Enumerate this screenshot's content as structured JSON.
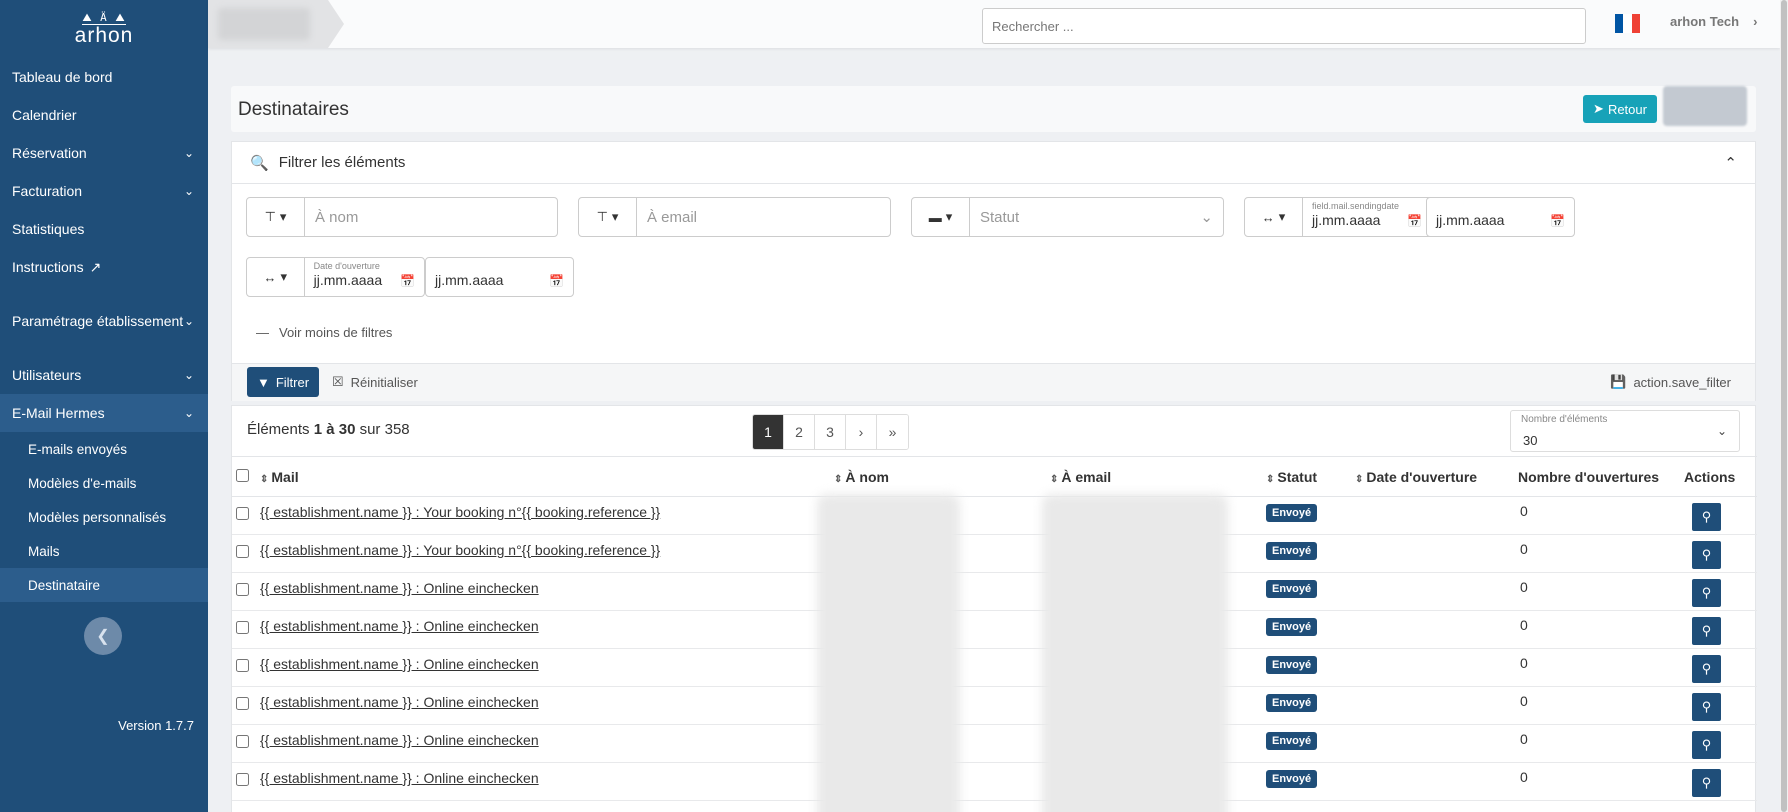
{
  "sidebar": {
    "logo_mark": "⛰ Ä ⛰",
    "logo_text": "arhon",
    "items": [
      {
        "label": "Tableau de bord",
        "has_chevron": false
      },
      {
        "label": "Calendrier",
        "has_chevron": false
      },
      {
        "label": "Réservation",
        "has_chevron": true
      },
      {
        "label": "Facturation",
        "has_chevron": true
      },
      {
        "label": "Statistiques",
        "has_chevron": false
      },
      {
        "label": "Instructions",
        "has_chevron": false,
        "external_icon": "external-link-icon"
      },
      {
        "label": "Paramétrage établissement",
        "has_chevron": true
      },
      {
        "label": "Utilisateurs",
        "has_chevron": true
      },
      {
        "label": "E-Mail Hermes",
        "has_chevron": true,
        "expanded": true
      }
    ],
    "sub_items": [
      {
        "label": "E-mails envoyés"
      },
      {
        "label": "Modèles d'e-mails"
      },
      {
        "label": "Modèles personnalisés"
      },
      {
        "label": "Mails"
      },
      {
        "label": "Destinataire",
        "active": true
      }
    ],
    "version": "Version 1.7.7"
  },
  "topbar": {
    "search_placeholder": "Rechercher ...",
    "user_name": "arhon Tech",
    "flag_colors": [
      "#0055a4",
      "#ffffff",
      "#ef4135"
    ]
  },
  "page": {
    "title": "Destinataires",
    "back_label": "Retour"
  },
  "filters": {
    "header": "Filtrer les éléments",
    "nom_placeholder": "À nom",
    "email_placeholder": "À email",
    "statut_placeholder": "Statut",
    "sending_date_label": "field.mail.sendingdate",
    "date_placeholder": "jj.mm.aaaa",
    "open_date_label": "Date d'ouverture",
    "voir_moins": "Voir moins de filtres",
    "filter_button": "Filtrer",
    "reset_button": "Réinitialiser",
    "save_button": "action.save_filter"
  },
  "list": {
    "count_prefix": "Éléments",
    "count_range": "1 à 30",
    "count_suffix": "sur 358",
    "pages": [
      "1",
      "2",
      "3"
    ],
    "per_page_label": "Nombre d'éléments",
    "per_page_value": "30",
    "columns": {
      "mail": "Mail",
      "nom": "À nom",
      "email": "À email",
      "statut": "Statut",
      "date_ouverture": "Date d'ouverture",
      "nb_ouvertures": "Nombre d'ouvertures",
      "actions": "Actions"
    },
    "rows": [
      {
        "mail": "{{ establishment.name }} : Your booking n°{{ booking.reference }}",
        "statut": "Envoyé",
        "ouvertures": "0"
      },
      {
        "mail": "{{ establishment.name }} : Your booking n°{{ booking.reference }}",
        "statut": "Envoyé",
        "ouvertures": "0"
      },
      {
        "mail": "{{ establishment.name }} : Online einchecken",
        "statut": "Envoyé",
        "ouvertures": "0"
      },
      {
        "mail": "{{ establishment.name }} : Online einchecken",
        "statut": "Envoyé",
        "ouvertures": "0"
      },
      {
        "mail": "{{ establishment.name }} : Online einchecken",
        "statut": "Envoyé",
        "ouvertures": "0"
      },
      {
        "mail": "{{ establishment.name }} : Online einchecken",
        "statut": "Envoyé",
        "ouvertures": "0"
      },
      {
        "mail": "{{ establishment.name }} : Online einchecken",
        "statut": "Envoyé",
        "ouvertures": "0"
      },
      {
        "mail": "{{ establishment.name }} : Online einchecken",
        "statut": "Envoyé",
        "ouvertures": "0"
      }
    ]
  }
}
